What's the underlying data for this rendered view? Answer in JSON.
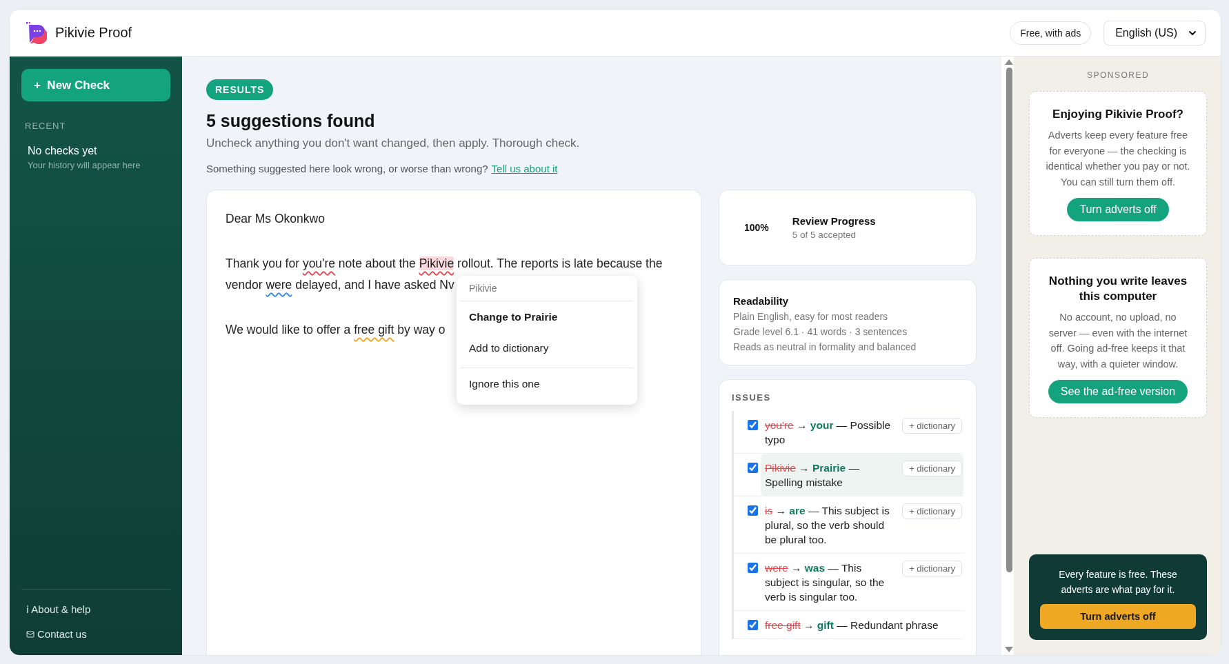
{
  "header": {
    "app_name": "Pikivie Proof",
    "plan_badge": "Free, with ads",
    "language": "English (US)"
  },
  "sidebar": {
    "new_button": "+  New Check",
    "recent_heading": "RECENT",
    "empty_title": "No checks yet",
    "empty_hint": "Your history will appear here",
    "footer_links": [
      {
        "kind": "info",
        "glyph": "ℹ",
        "label": "About & help"
      },
      {
        "kind": "mail",
        "label": "Contact us"
      }
    ]
  },
  "results": {
    "badge": "RESULTS",
    "title": "5 suggestions found",
    "subtitle": "Uncheck anything you don't want changed, then apply. Thorough check.",
    "feedback": "Something suggested here look wrong, or worse than wrong?",
    "feedback_link": "Tell us about it"
  },
  "document": {
    "paragraphs": [
      {
        "lines": [
          [
            {
              "text": "Dear Ms Okonkwo"
            }
          ]
        ]
      },
      {
        "lines": [
          [
            {
              "text": "Thank you for "
            },
            {
              "text": "you're",
              "kind": "spelling",
              "active": false
            },
            {
              "text": " note about the "
            },
            {
              "text": "Pikivie",
              "kind": "spelling",
              "active": true
            },
            {
              "text": " rollout. The reports is late because the"
            }
          ],
          [
            {
              "text": "vendor "
            },
            {
              "text": "were",
              "kind": "grammar",
              "active": false
            },
            {
              "text": " delayed, and I have asked Nv"
            }
          ]
        ]
      },
      {
        "lines": [
          [
            {
              "text": "We would like to offer a "
            },
            {
              "text": "free gift",
              "kind": "style",
              "active": false
            },
            {
              "text": " by way o"
            }
          ]
        ]
      }
    ]
  },
  "context_menu": {
    "word": "Pikivie",
    "items": [
      {
        "label": "Change to Prairie",
        "kind": "primary"
      },
      {
        "label": "Add to dictionary",
        "kind": "normal"
      },
      {
        "label": "Ignore this one",
        "kind": "separated"
      }
    ]
  },
  "progress": {
    "percent": "100%",
    "title": "Review Progress",
    "detail": "5 of 5 accepted"
  },
  "readability": {
    "title": "Readability",
    "lines": [
      "Plain English, easy for most readers",
      "Grade level 6.1 · 41 words · 3 sentences",
      "Reads as neutral in formality and balanced"
    ]
  },
  "issues": {
    "heading": "ISSUES",
    "items": [
      {
        "checked": true,
        "selected": false,
        "original": "you're",
        "arrow": "→",
        "replacement": "your",
        "note": "— Possible typo",
        "action": "+ dictionary"
      },
      {
        "checked": true,
        "selected": true,
        "original": "Pikivie",
        "arrow": "→",
        "replacement": "Prairie",
        "note": "— Spelling mistake",
        "action": "+ dictionary"
      },
      {
        "checked": true,
        "selected": false,
        "original": "is",
        "arrow": "→",
        "replacement": "are",
        "note": "— This subject is plural, so the verb should be plural too.",
        "action": "+ dictionary"
      },
      {
        "checked": true,
        "selected": false,
        "original": "were",
        "arrow": "→",
        "replacement": "was",
        "note": "— This subject is singular, so the verb is singular too.",
        "action": "+ dictionary"
      },
      {
        "checked": true,
        "selected": false,
        "original": "free gift",
        "arrow": "→",
        "replacement": "gift",
        "note": "— Redundant phrase"
      }
    ]
  },
  "ads": {
    "label": "SPONSORED",
    "cards": [
      {
        "title": "Enjoying Pikivie Proof?",
        "body": "Adverts keep every feature free for everyone — the checking is identical whether you pay or not. You can still turn them off.",
        "button": "Turn adverts off"
      },
      {
        "title": "Nothing you write leaves this computer",
        "body": "No account, no upload, no server — even with the internet off. Going ad-free keeps it that way, with a quieter window.",
        "button": "See the ad-free version"
      }
    ],
    "footer": {
      "text": "Every feature is free. These adverts are what pay for it.",
      "button": "Turn adverts off"
    }
  }
}
